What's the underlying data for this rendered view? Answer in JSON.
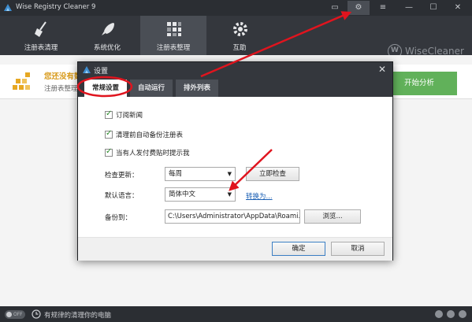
{
  "window": {
    "title": "Wise Registry Cleaner 9",
    "controls": [
      "▭",
      "⚙",
      "≡",
      "—",
      "☐",
      "✕"
    ]
  },
  "toolbar": {
    "items": [
      {
        "label": "注册表清理",
        "icon": "broom-icon"
      },
      {
        "label": "系统优化",
        "icon": "rocket-icon"
      },
      {
        "label": "注册表整理",
        "icon": "defrag-grid-icon"
      },
      {
        "label": "互助",
        "icon": "gear-icon"
      }
    ],
    "brand": "WiseCleaner",
    "brand_mark": "W"
  },
  "banner": {
    "heading": "您还没有数",
    "subtext": "注册表整理",
    "action": "开始分析"
  },
  "status": {
    "toggle": "OFF",
    "text": "有规律的清理你的电脑"
  },
  "dialog": {
    "title": "设置",
    "tabs": [
      "常规设置",
      "自动运行",
      "排外列表"
    ],
    "checkboxes": [
      {
        "label": "订阅新闻",
        "checked": true
      },
      {
        "label": "清理前自动备份注册表",
        "checked": true
      },
      {
        "label": "当有人发付费贴时提示我",
        "checked": true
      }
    ],
    "check_update_label": "检查更新：",
    "check_update_value": "每周",
    "check_now": "立即检查",
    "language_label": "默认语言：",
    "language_value": "简体中文",
    "translate_link": "转换为...",
    "backup_label": "备份到：",
    "backup_path": "C:\\Users\\Administrator\\AppData\\Roami...",
    "browse": "浏览...",
    "ok": "确定",
    "cancel": "取消"
  },
  "colors": {
    "title_bar": "#2b2e33",
    "dialog_header": "#34373d",
    "accent_green": "#61b15a",
    "annotation_red": "#e0141e"
  }
}
